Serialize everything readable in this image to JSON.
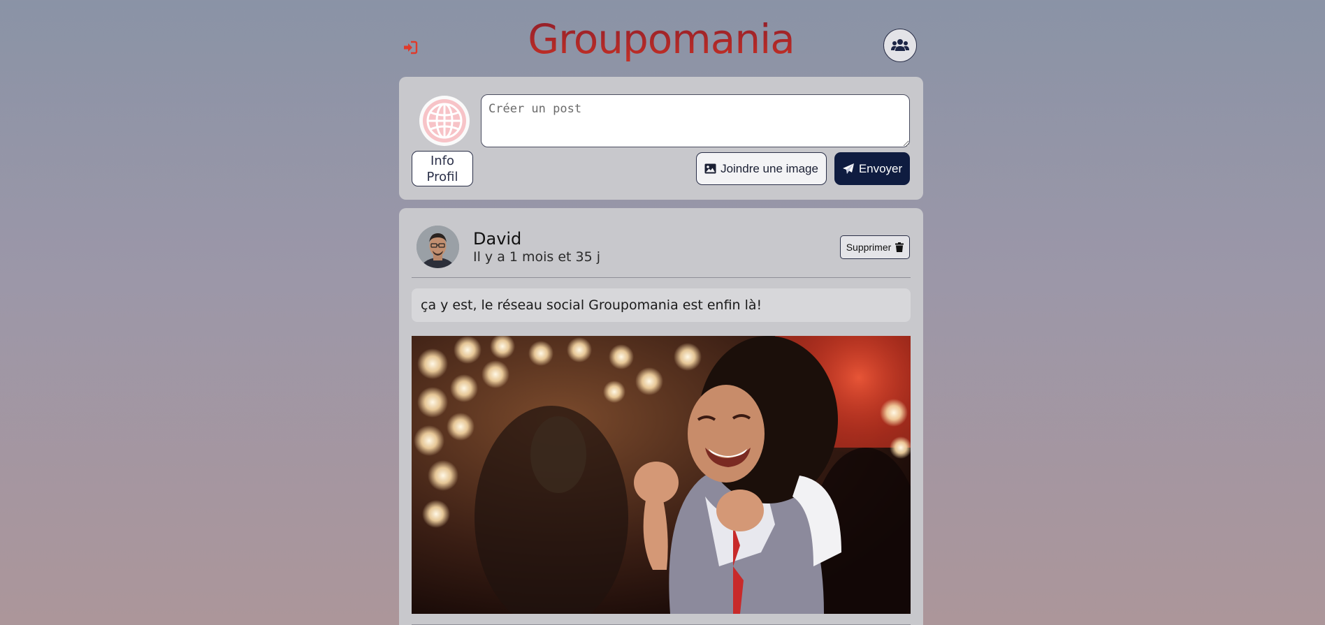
{
  "header": {
    "brand": "Groupomania",
    "logout_icon": "logout-icon",
    "users_icon": "users-icon"
  },
  "create_post": {
    "profile_icon": "globe-icon",
    "info_profil_label": "Info Profil",
    "textarea_placeholder": "Créer un post",
    "textarea_value": "",
    "join_image_label": "Joindre une image",
    "send_label": "Envoyer"
  },
  "posts": [
    {
      "author": "David",
      "time": "Il y a 1 mois et 35 j",
      "delete_label": "Supprimer",
      "text": "ça y est, le réseau social Groupomania est enfin là!",
      "image_alt": "girl-celebrating-gif"
    }
  ],
  "colors": {
    "brand_red": "#c93125",
    "primary_navy": "#0f1c40",
    "logout_red": "#e03a2a"
  }
}
